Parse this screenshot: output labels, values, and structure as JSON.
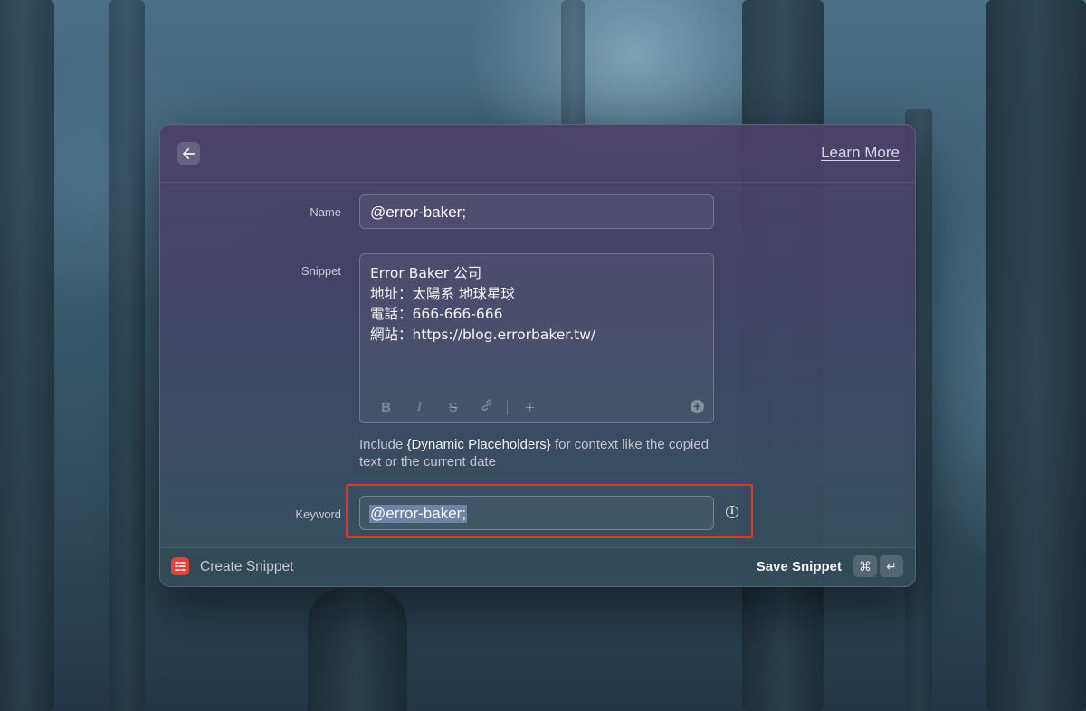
{
  "header": {
    "back_icon": "arrow-left-icon",
    "learn_more": "Learn More"
  },
  "form": {
    "name_label": "Name",
    "name_value": "@error-baker;",
    "snippet_label": "Snippet",
    "snippet_lines": [
      "Error Baker 公司",
      "地址：太陽系 地球星球",
      "電話：666-666-666",
      "網站：https://blog.errorbaker.tw/"
    ],
    "toolbar": {
      "bold": "B",
      "italic": "I",
      "strike": "S",
      "link_icon": "link-icon",
      "clear_format": "T",
      "add_icon": "plus-circle-icon"
    },
    "hint_prefix": "Include ",
    "hint_placeholder": "{Dynamic Placeholders}",
    "hint_suffix": " for context like the copied text or the current date",
    "keyword_label": "Keyword",
    "keyword_value": "@error-baker;",
    "info_icon": "info-icon"
  },
  "footer": {
    "app_icon": "snippet-app-icon",
    "create_label": "Create Snippet",
    "save_label": "Save Snippet",
    "shortcut_cmd": "⌘",
    "shortcut_enter": "↵"
  },
  "colors": {
    "highlight": "#e0362f",
    "app_accent": "#e5423a"
  }
}
